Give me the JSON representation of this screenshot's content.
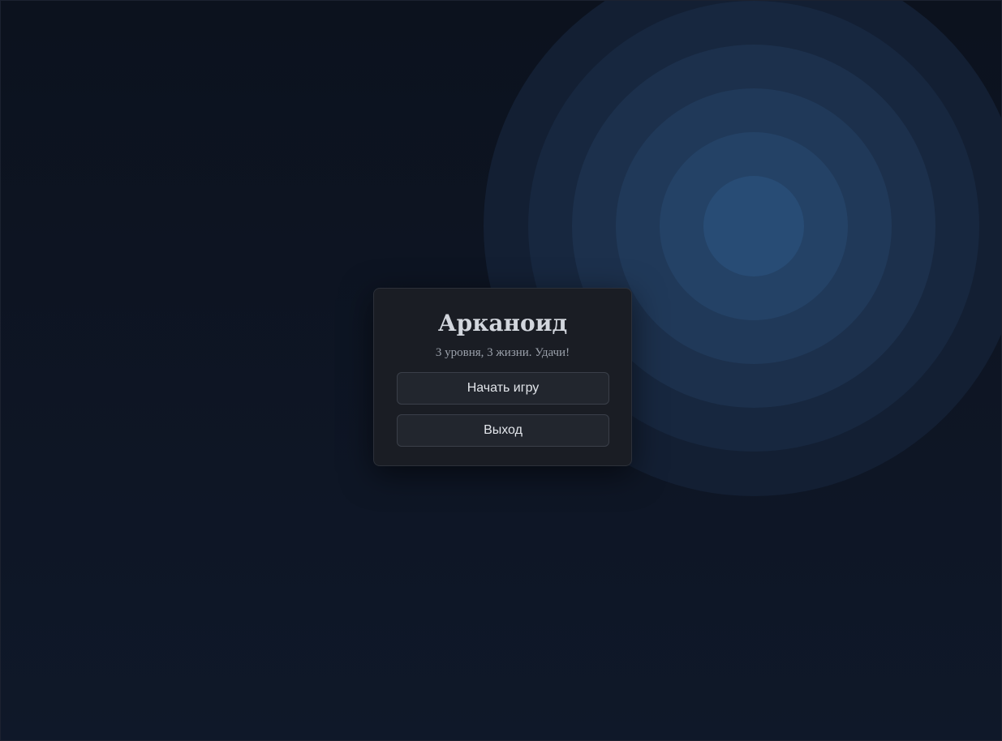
{
  "menu": {
    "title": "Арканоид",
    "subtitle": "3 уровня, 3 жизни. Удачи!",
    "start_label": "Начать игру",
    "exit_label": "Выход"
  },
  "colors": {
    "background": "#0d1320",
    "card": "#1a1d24",
    "button": "#22262e",
    "ring_outer": "#142238",
    "ring_inner": "#284c78"
  }
}
